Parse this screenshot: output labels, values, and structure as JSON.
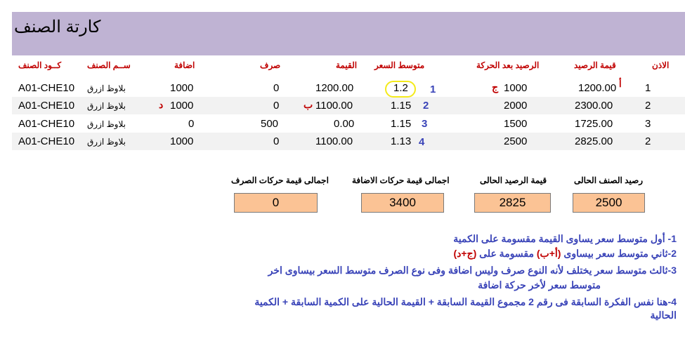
{
  "page": {
    "title": "كارتة الصنف"
  },
  "columns": {
    "code": "كــود الصنف",
    "name": "ســم الصنف",
    "add": "اضافة",
    "spend": "صرف",
    "value": "القيمة",
    "avg": "متوسط السعر",
    "balance_after": "الرصيد بعد الحركة",
    "balance_value": "قيمة الرصيد",
    "permit": "الاذن"
  },
  "rows": [
    {
      "code": "A01-CHE10",
      "name": "بلاوظ ازرق",
      "add": "1000",
      "spend": "0",
      "value": "1200.00",
      "avg": "1.2",
      "balance": "1000",
      "balance_value": "1200.00",
      "permit": "1"
    },
    {
      "code": "A01-CHE10",
      "name": "بلاوظ ازرق",
      "add": "1000",
      "spend": "0",
      "value": "1100.00",
      "avg": "1.15",
      "balance": "2000",
      "balance_value": "2300.00",
      "permit": "2"
    },
    {
      "code": "A01-CHE10",
      "name": "بلاوظ ازرق",
      "add": "0",
      "spend": "500",
      "value": "0.00",
      "avg": "1.15",
      "balance": "1500",
      "balance_value": "1725.00",
      "permit": "3"
    },
    {
      "code": "A01-CHE10",
      "name": "بلاوظ ازرق",
      "add": "1000",
      "spend": "0",
      "value": "1100.00",
      "avg": "1.13",
      "balance": "2500",
      "balance_value": "2825.00",
      "permit": "2"
    }
  ],
  "markers": {
    "alef": "أ",
    "jeem": "ج",
    "beh": "ب",
    "dal": "د",
    "n1": "1",
    "n2": "2",
    "n3": "3",
    "n4": "4"
  },
  "summary": {
    "spend_total_label": "اجمالى قيمة حركات الصرف",
    "spend_total_value": "0",
    "add_total_label": "اجمالى قيمة حركات الاضافة",
    "add_total_value": "3400",
    "current_value_label": "قيمة الرصيد الحالى",
    "current_value_value": "2825",
    "current_balance_label": "رصيد الصنف الحالى",
    "current_balance_value": "2500"
  },
  "notes": {
    "n1": "1- أول متوسط سعر يساوى القيمة مقسومة على الكمية",
    "n2_a": "2-ثاني متوسط سعر بيساوى ",
    "n2_b": "(أ+ب)",
    "n2_c": " مقسومة على ",
    "n2_d": "(ج+د)",
    "n3_a": "3-ثالث متوسط سعر يختلف لأنه النوع صرف وليس اضافة وفى نوع الصرف متوسط السعر بيساوى اخر",
    "n3_b": "متوسط سعر لأخر حركة اضافة",
    "n4_a": "4-هنا نفس الفكرة السابقة فى رقم 2  مجموع القيمة السابقة + القيمة الحالية على الكمية السابقة + الكمية",
    "n4_b": "الحالية"
  },
  "colors": {
    "header_bg": "#bfb3d3",
    "box_bg": "#fbc395",
    "header_red": "#c00000",
    "note_blue": "#3a44b8",
    "highlight": "#f4ea1a"
  }
}
